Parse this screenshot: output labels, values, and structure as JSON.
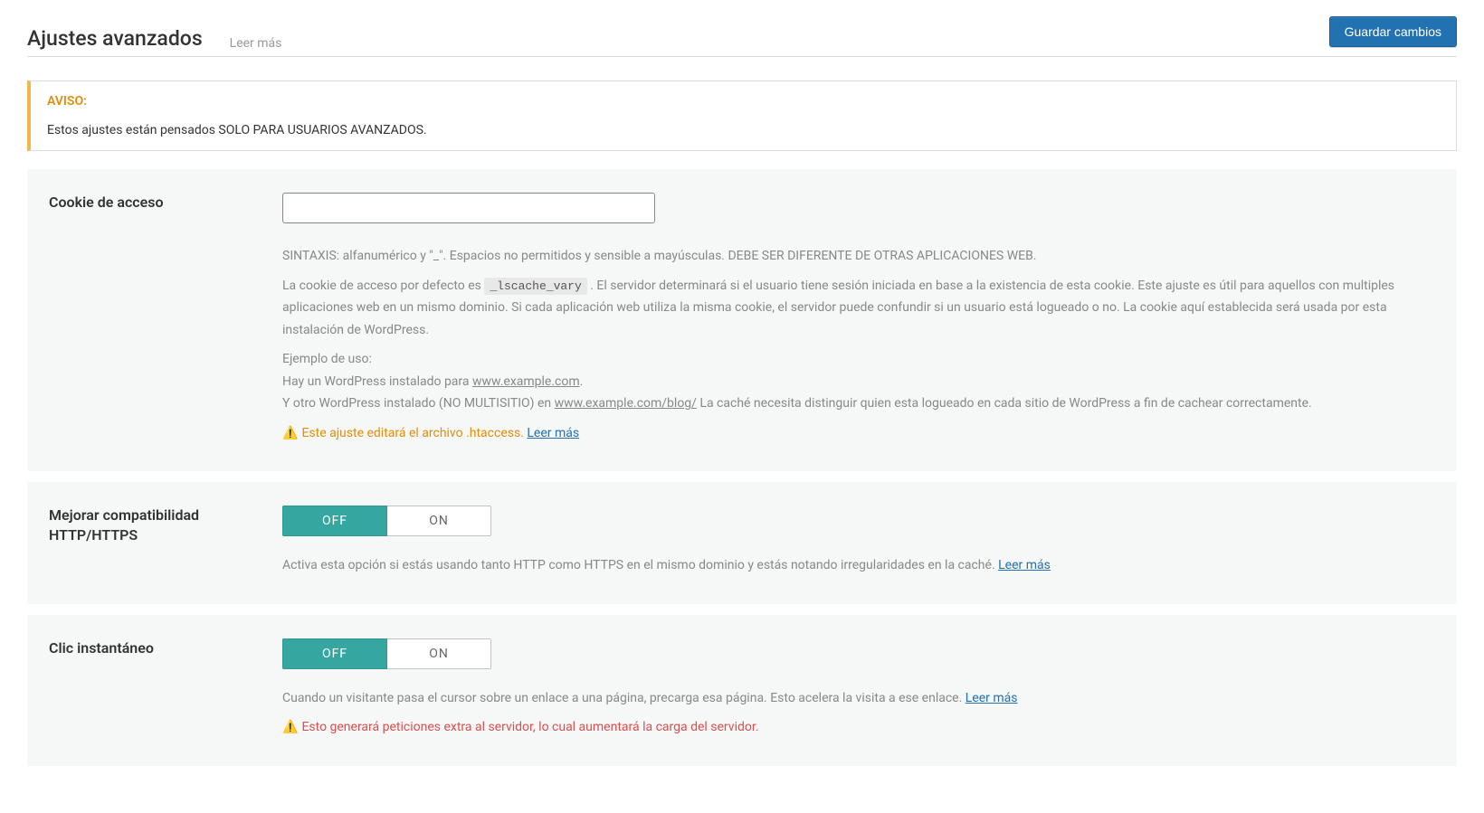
{
  "header": {
    "title": "Ajustes avanzados",
    "read_more": "Leer más",
    "save_button": "Guardar cambios"
  },
  "notice": {
    "title": "AVISO:",
    "text": "Estos ajustes están pensados SOLO PARA USUARIOS AVANZADOS."
  },
  "cookie": {
    "label": "Cookie de acceso",
    "value": "",
    "syntax": "SINTAXIS: alfanumérico y \"_\". Espacios no permitidos y sensible a mayúsculas. DEBE SER DIFERENTE DE OTRAS APLICACIONES WEB.",
    "default_pre": "La cookie de acceso por defecto es ",
    "default_code": "_lscache_vary",
    "default_post": " . El servidor determinará si el usuario tiene sesión iniciada en base a la existencia de esta cookie. Este ajuste es útil para aquellos con multiples aplicaciones web en un mismo dominio. Si cada aplicación web utiliza la misma cookie, el servidor puede confundir si un usuario está logueado o no. La cookie aquí establecida será usada por esta instalación de WordPress.",
    "example_heading": "Ejemplo de uso:",
    "example_line1_pre": "Hay un WordPress instalado para ",
    "example_link1": "www.example.com",
    "example_line1_post": ".",
    "example_line2_pre": "Y otro WordPress instalado (NO MULTISITIO) en ",
    "example_link2": "www.example.com/blog/",
    "example_line2_post": " La caché necesita distinguir quien esta logueado en cada sitio de WordPress a fin de cachear correctamente.",
    "warn_icon": "⚠️",
    "warn_text": "Este ajuste editará el archivo .htaccess. ",
    "warn_link": "Leer más"
  },
  "http_https": {
    "label": "Mejorar compatibilidad HTTP/HTTPS",
    "off": "OFF",
    "on": "ON",
    "desc": "Activa esta opción si estás usando tanto HTTP como HTTPS en el mismo dominio y estás notando irregularidades en la caché. ",
    "desc_link": "Leer más",
    "state": "off"
  },
  "instant_click": {
    "label": "Clic instantáneo",
    "off": "OFF",
    "on": "ON",
    "desc": "Cuando un visitante pasa el cursor sobre un enlace a una página, precarga esa página. Esto acelera la visita a ese enlace. ",
    "desc_link": "Leer más",
    "warn_icon": "⚠️",
    "warn_text": "Esto generará peticiones extra al servidor, lo cual aumentará la carga del servidor.",
    "state": "off"
  }
}
